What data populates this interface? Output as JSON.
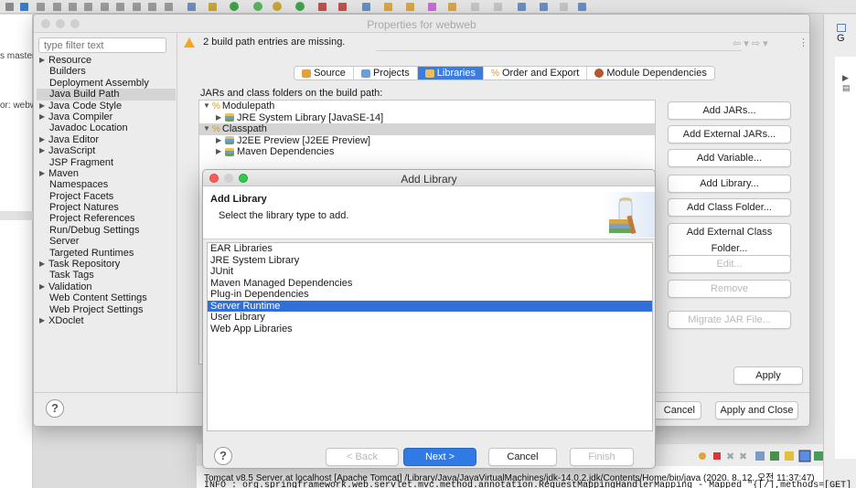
{
  "eclipse": {
    "left_texts": [
      "s master",
      "or: webw"
    ],
    "right_header": "G",
    "console_line1": "Tomcat v8.5 Server at localhost [Apache Tomcat] /Library/Java/JavaVirtualMachines/jdk-14.0.2.jdk/Contents/Home/bin/java  (2020. 8. 12. 오전 11:37:47)",
    "console_line2": "INFO : org.springframework.web.servlet.mvc.method.annotation.RequestMappingHandlerMapping - Mapped \"{[/],methods=[GET]"
  },
  "props": {
    "title": "Properties for webweb",
    "filter_placeholder": "type filter text",
    "warning": "2 build path entries are missing.",
    "tree": [
      {
        "label": "Resource",
        "expandable": true
      },
      {
        "label": "Builders",
        "expandable": false
      },
      {
        "label": "Deployment Assembly",
        "expandable": false
      },
      {
        "label": "Java Build Path",
        "expandable": false,
        "selected": true
      },
      {
        "label": "Java Code Style",
        "expandable": true
      },
      {
        "label": "Java Compiler",
        "expandable": true
      },
      {
        "label": "Javadoc Location",
        "expandable": false
      },
      {
        "label": "Java Editor",
        "expandable": true
      },
      {
        "label": "JavaScript",
        "expandable": true
      },
      {
        "label": "JSP Fragment",
        "expandable": false
      },
      {
        "label": "Maven",
        "expandable": true
      },
      {
        "label": "Namespaces",
        "expandable": false
      },
      {
        "label": "Project Facets",
        "expandable": false
      },
      {
        "label": "Project Natures",
        "expandable": false
      },
      {
        "label": "Project References",
        "expandable": false
      },
      {
        "label": "Run/Debug Settings",
        "expandable": false
      },
      {
        "label": "Server",
        "expandable": false
      },
      {
        "label": "Targeted Runtimes",
        "expandable": false
      },
      {
        "label": "Task Repository",
        "expandable": true
      },
      {
        "label": "Task Tags",
        "expandable": false
      },
      {
        "label": "Validation",
        "expandable": true
      },
      {
        "label": "Web Content Settings",
        "expandable": false
      },
      {
        "label": "Web Project Settings",
        "expandable": false
      },
      {
        "label": "XDoclet",
        "expandable": true
      }
    ],
    "tabs": [
      {
        "label": "Source",
        "active": false
      },
      {
        "label": "Projects",
        "active": false
      },
      {
        "label": "Libraries",
        "active": true
      },
      {
        "label": "Order and Export",
        "active": false
      },
      {
        "label": "Module Dependencies",
        "active": false
      }
    ],
    "jars_label": "JARs and class folders on the build path:",
    "entries": [
      {
        "label": "Modulepath",
        "indent": 0,
        "open": true,
        "selected": false
      },
      {
        "label": "JRE System Library [JavaSE-14]",
        "indent": 1,
        "open": false,
        "selected": false
      },
      {
        "label": "Classpath",
        "indent": 0,
        "open": true,
        "selected": true
      },
      {
        "label": "J2EE Preview [J2EE Preview]",
        "indent": 1,
        "open": false,
        "selected": false
      },
      {
        "label": "Maven Dependencies",
        "indent": 1,
        "open": false,
        "selected": false
      }
    ],
    "side_buttons": [
      "Add JARs...",
      "Add External JARs...",
      "Add Variable...",
      "Add Library...",
      "Add Class Folder...",
      "Add External Class Folder...",
      "Edit...",
      "Remove",
      "Migrate JAR File..."
    ],
    "apply": "Apply",
    "cancel": "Cancel",
    "apply_close": "Apply and Close",
    "help": "?"
  },
  "dialog": {
    "title": "Add Library",
    "heading": "Add Library",
    "subtitle": "Select the library type to add.",
    "libraries": [
      "EAR Libraries",
      "JRE System Library",
      "JUnit",
      "Maven Managed Dependencies",
      "Plug-in Dependencies",
      "Server Runtime",
      "User Library",
      "Web App Libraries"
    ],
    "selected": "Server Runtime",
    "back": "< Back",
    "next": "Next >",
    "cancel": "Cancel",
    "finish": "Finish",
    "help": "?"
  },
  "colors": {
    "selection": "#2f6fd6",
    "tree_selection": "#d4d4d4",
    "next_button": "#2f7ae5",
    "warning": "#f5a623"
  }
}
